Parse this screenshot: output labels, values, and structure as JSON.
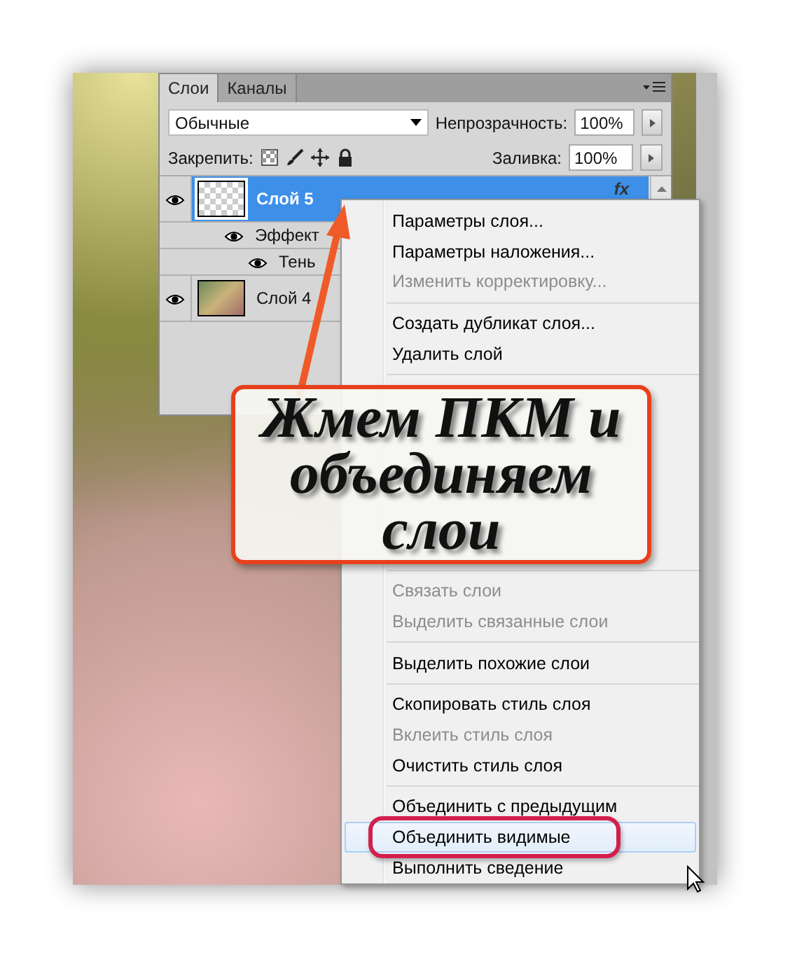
{
  "layers_panel": {
    "tabs": [
      {
        "label": "Слои",
        "selected": true
      },
      {
        "label": "Каналы",
        "selected": false
      }
    ],
    "blend_mode": "Обычные",
    "opacity_label": "Непрозрачность:",
    "opacity": "100%",
    "lock_label": "Закрепить:",
    "fill_label": "Заливка:",
    "fill": "100%",
    "layers": [
      {
        "name": "Слой 5",
        "visible": true,
        "selected": true,
        "effects_badge": "fx",
        "children": [
          {
            "name": "Эффект",
            "visible": true,
            "children": [
              {
                "name": "Тень",
                "visible": true
              }
            ]
          }
        ]
      },
      {
        "name": "Слой 4",
        "visible": true,
        "selected": false
      }
    ]
  },
  "context_menu": {
    "groups": [
      [
        {
          "label": "Параметры слоя...",
          "disabled": false,
          "selected": false
        },
        {
          "label": "Параметры наложения...",
          "disabled": false,
          "selected": false
        },
        {
          "label": "Изменить корректировку...",
          "disabled": true,
          "selected": false
        }
      ],
      [
        {
          "label": "Создать дубликат слоя...",
          "disabled": false,
          "selected": false
        },
        {
          "label": "Удалить слой",
          "disabled": false,
          "selected": false
        }
      ],
      [
        {
          "label": "Связать слои",
          "disabled": true,
          "selected": false
        },
        {
          "label": "Выделить связанные слои",
          "disabled": true,
          "selected": false
        }
      ],
      [
        {
          "label": "Выделить похожие слои",
          "disabled": false,
          "selected": false
        }
      ],
      [
        {
          "label": "Скопировать стиль слоя",
          "disabled": false,
          "selected": false
        },
        {
          "label": "Вклеить стиль слоя",
          "disabled": true,
          "selected": false
        },
        {
          "label": "Очистить стиль слоя",
          "disabled": false,
          "selected": false
        }
      ],
      [
        {
          "label": "Объединить с предыдущим",
          "disabled": false,
          "selected": false
        },
        {
          "label": "Объединить видимые",
          "disabled": false,
          "selected": true
        },
        {
          "label": "Выполнить сведение",
          "disabled": false,
          "selected": false
        }
      ]
    ]
  },
  "callout": {
    "text": "Жмем ПКМ и объединяем слои"
  }
}
